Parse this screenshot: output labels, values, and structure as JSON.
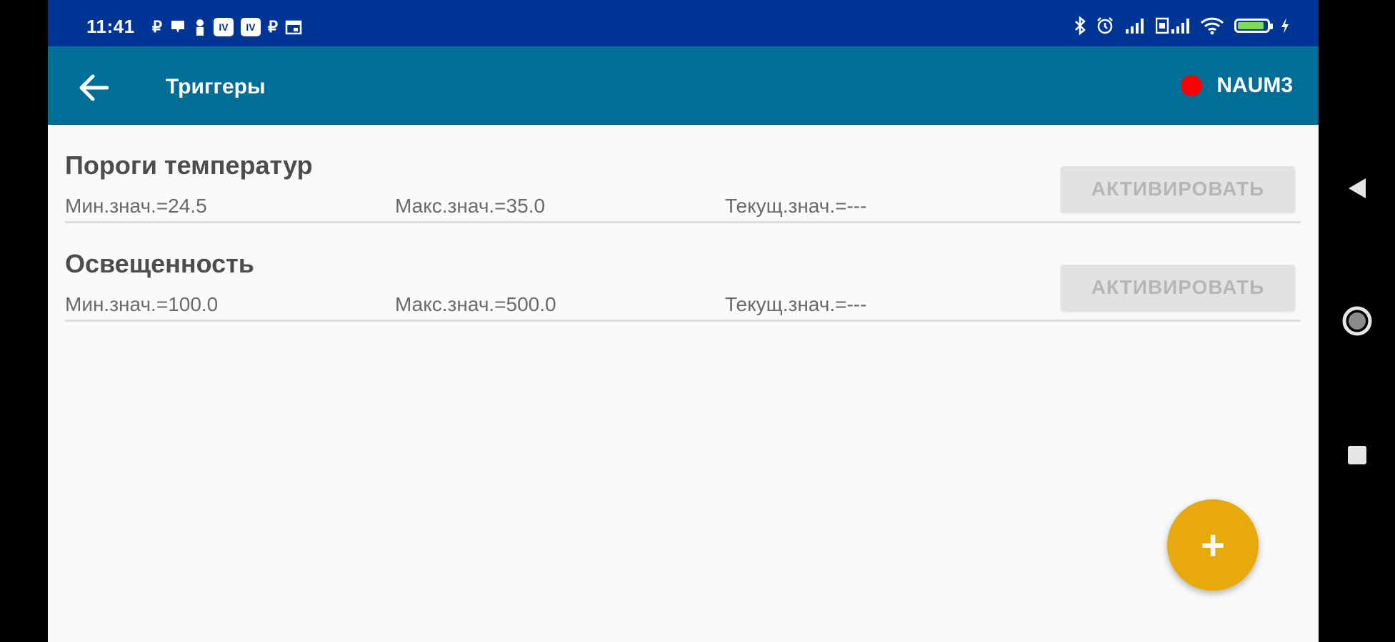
{
  "status_bar": {
    "time": "11:41",
    "left_icons": [
      "ruble-icon",
      "notification-icon",
      "person-icon",
      "iv-icon",
      "iv-icon",
      "ruble-icon",
      "calendar-icon"
    ],
    "right_icons": [
      "bluetooth-icon",
      "alarm-icon",
      "signal-icon",
      "sim-signal-icon",
      "wifi-icon",
      "battery-icon",
      "charging-icon"
    ],
    "battery_color": "#7ed957"
  },
  "app_bar": {
    "title": "Триггеры",
    "device_name": "NAUM3",
    "device_status_color": "#ff0000",
    "background": "#006e96"
  },
  "triggers": [
    {
      "title": "Пороги температур",
      "min": "Мин.знач.=24.5",
      "max": "Макс.знач.=35.0",
      "current": "Текущ.знач.=---",
      "button": "АКТИВИРОВАТЬ"
    },
    {
      "title": "Освещенность",
      "min": "Мин.знач.=100.0",
      "max": "Макс.знач.=500.0",
      "current": "Текущ.знач.=---",
      "button": "АКТИВИРОВАТЬ"
    }
  ],
  "fab": {
    "label": "+",
    "color": "#e8a90c"
  },
  "nav_bar": {
    "buttons": [
      "back-triangle-icon",
      "home-circle-icon",
      "recents-square-icon"
    ]
  }
}
